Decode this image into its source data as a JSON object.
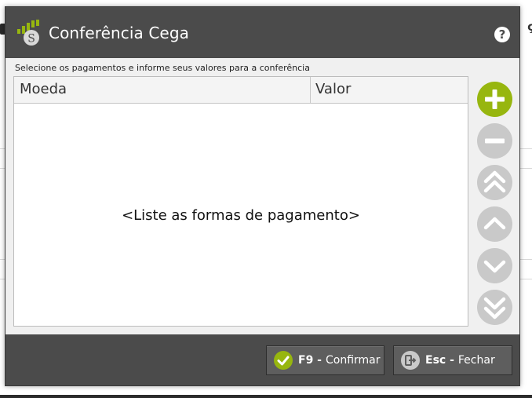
{
  "dialog": {
    "title": "Conferência Cega",
    "help_label": "?",
    "instructions": "Selecione os pagamentos e informe seus valores para a conferência"
  },
  "table": {
    "columns": [
      "Moeda",
      "Valor"
    ],
    "empty_message": "<Liste as formas de pagamento>"
  },
  "side_buttons": [
    {
      "icon": "plus-icon"
    },
    {
      "icon": "minus-icon"
    },
    {
      "icon": "double-chevron-up-icon"
    },
    {
      "icon": "chevron-up-icon"
    },
    {
      "icon": "chevron-down-icon"
    },
    {
      "icon": "double-chevron-down-icon"
    }
  ],
  "footer": {
    "confirm_key": "F9 -",
    "confirm_label": "Confirmar",
    "close_key": "Esc -",
    "close_label": "Fechar"
  },
  "background": {
    "right_fragment": "ç"
  },
  "colors": {
    "accent_green": "#97b60f",
    "titlebar": "#4b4b4b",
    "disabled_button": "#c9c9c9"
  }
}
